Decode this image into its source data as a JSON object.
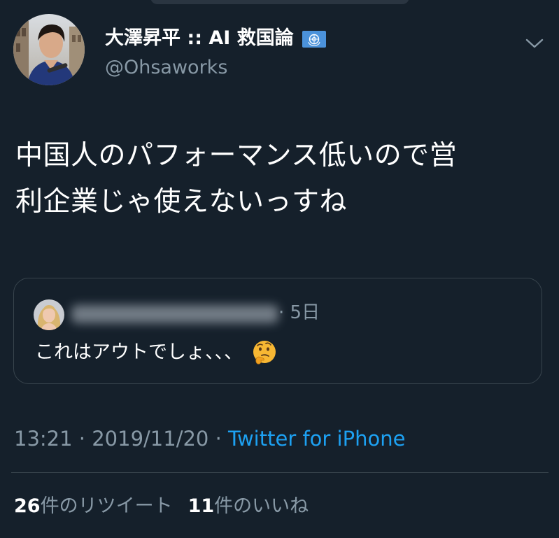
{
  "tweet": {
    "author": {
      "display_name": "大澤昇平 :: AI 救国論",
      "handle": "@Ohsaworks"
    },
    "text_lines": [
      "中国人のパフォーマンス低いので営",
      "利企業じゃ使えないっすね"
    ],
    "quoted_tweet": {
      "time": "· 5日",
      "text": "これはアウトでしょ、、、"
    },
    "meta": {
      "time": "13:21",
      "separator1": " · ",
      "date": "2019/11/20",
      "separator2": " · ",
      "source": "Twitter for iPhone"
    },
    "stats": {
      "retweets_count": "26",
      "retweets_label": "件のリツイート",
      "likes_count": "11",
      "likes_label": "件のいいね"
    }
  },
  "colors": {
    "background": "#15202b",
    "text_primary": "#ffffff",
    "text_secondary": "#8899a6",
    "link": "#1da1f2",
    "border": "#38444d",
    "un_flag": "#4b92db"
  },
  "icons": {
    "flag": "united-nations-flag-icon",
    "menu": "chevron-down-icon",
    "emoji": "thinking-face-emoji"
  }
}
